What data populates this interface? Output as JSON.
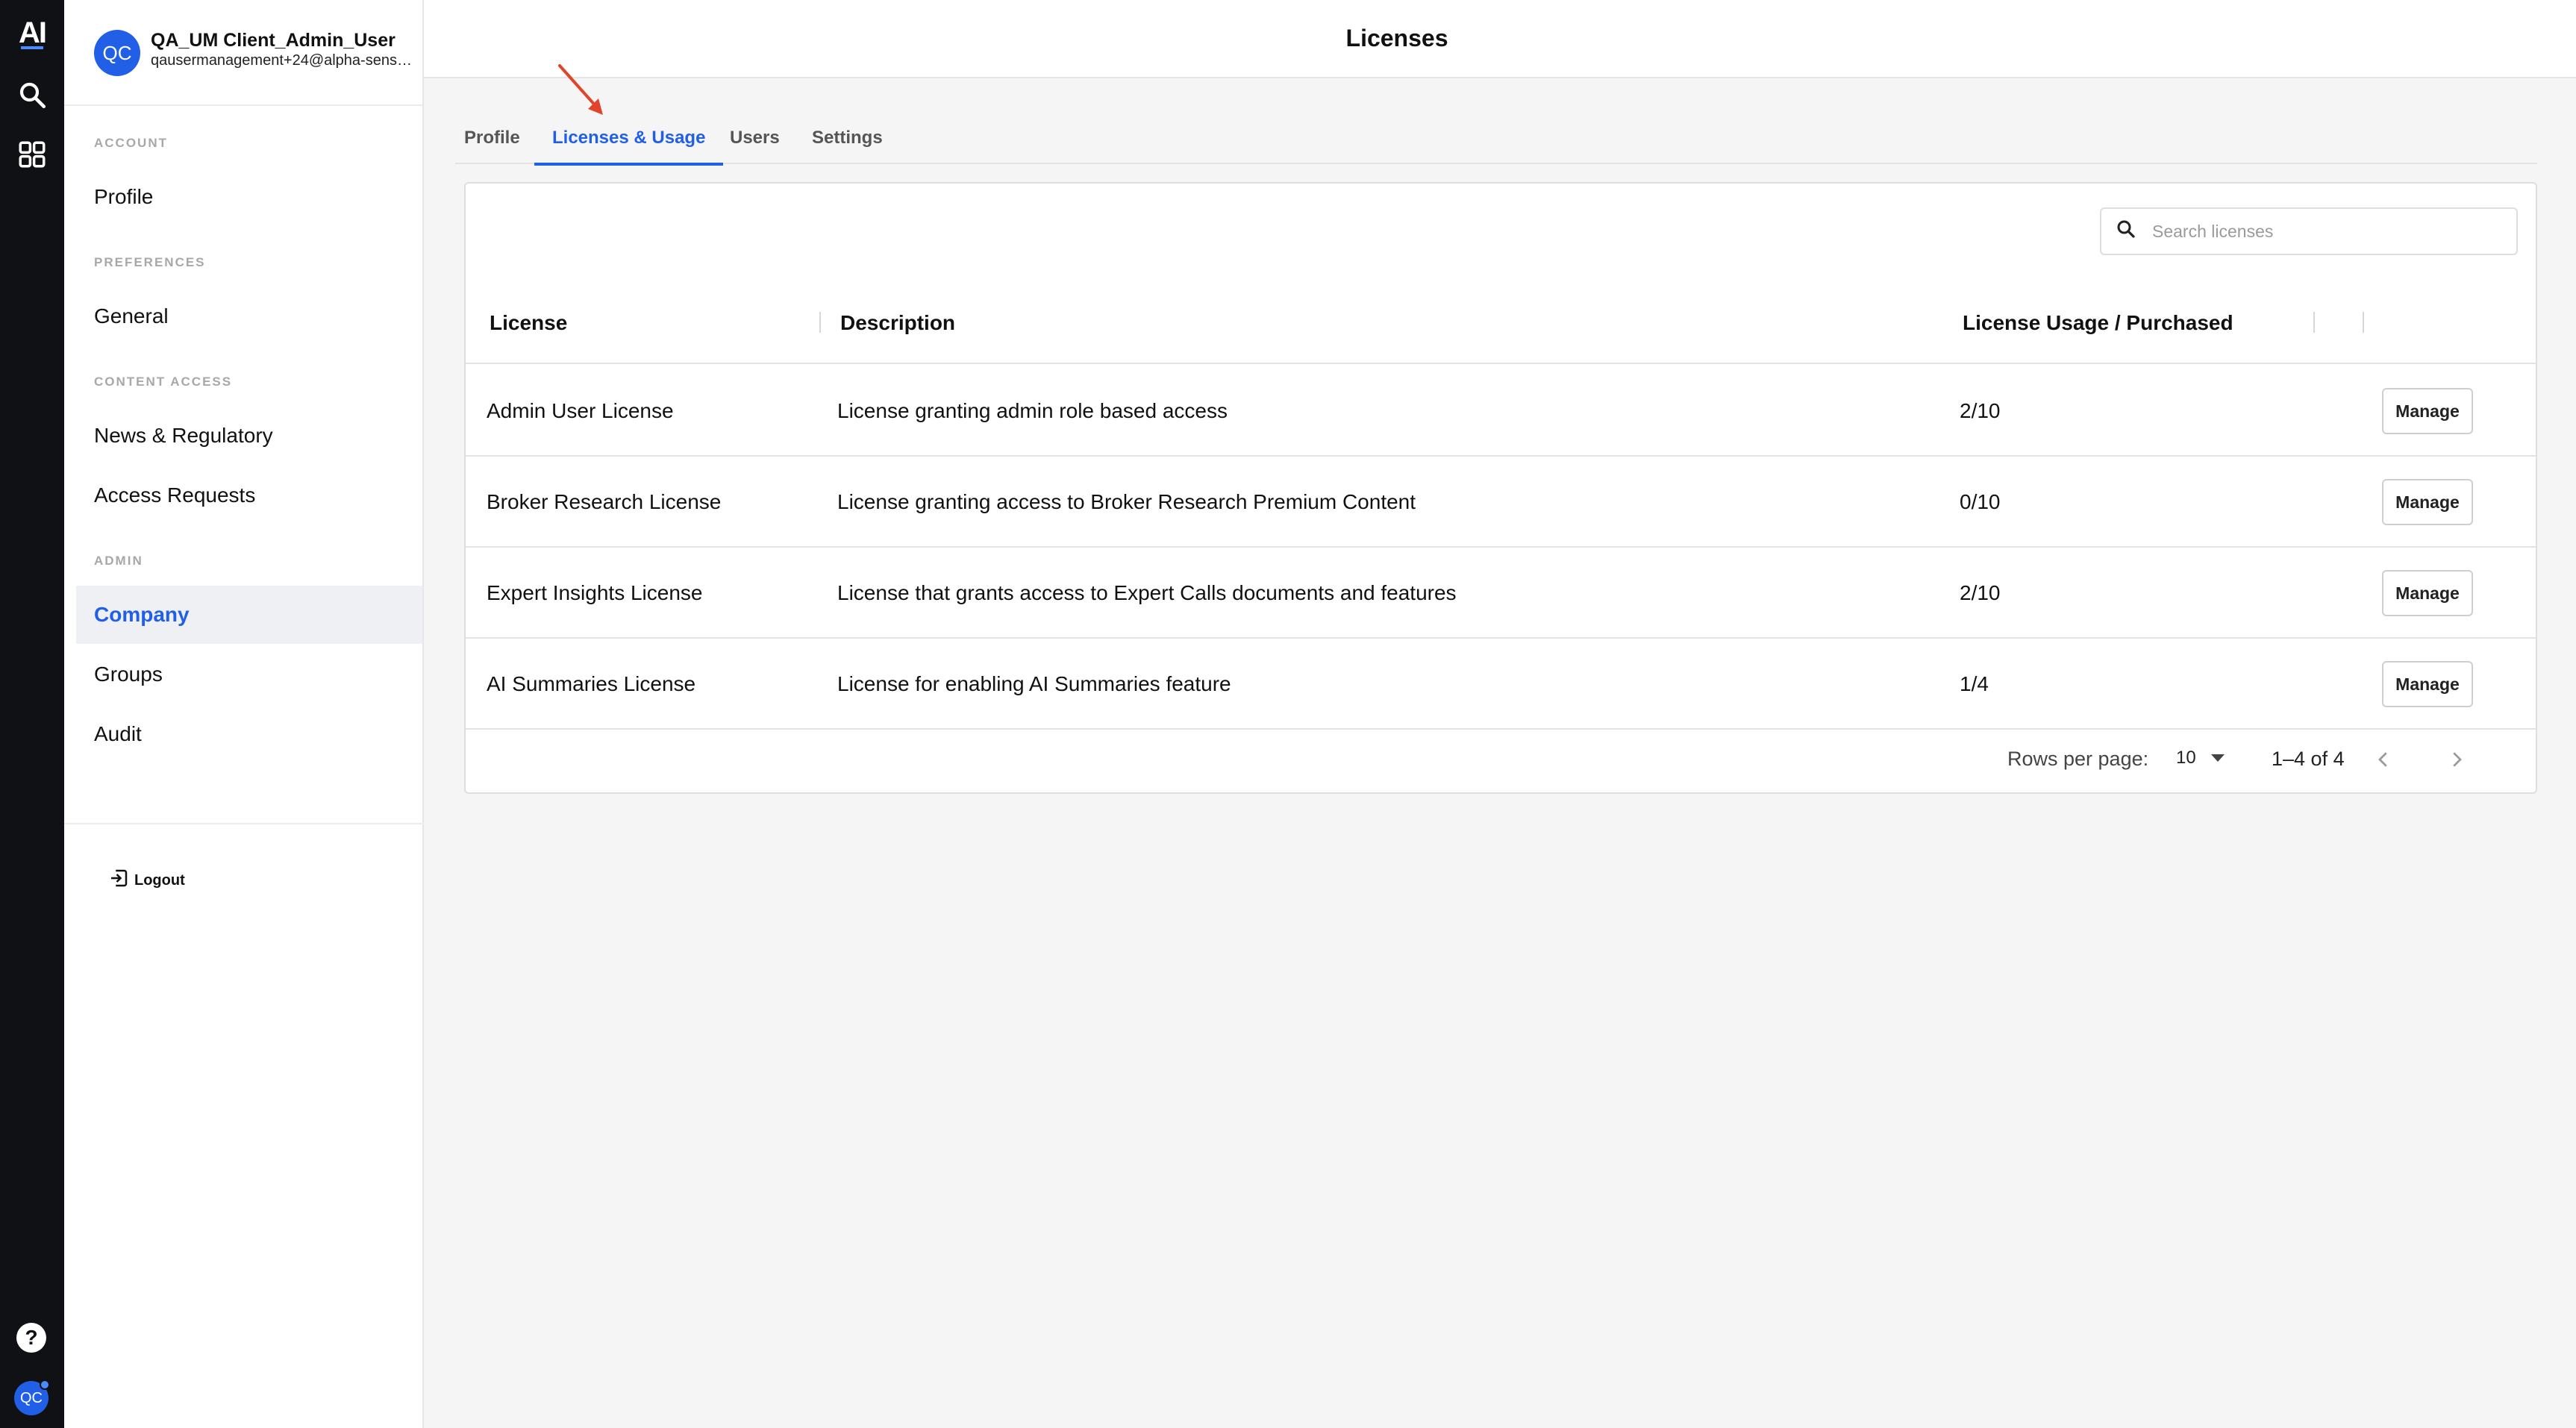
{
  "rail": {
    "logo": "AI",
    "help": "?",
    "avatar": "QC"
  },
  "user": {
    "initials": "QC",
    "name": "QA_UM Client_Admin_User",
    "email": "qausermanagement+24@alpha-sense.com"
  },
  "sidebar": {
    "sections": {
      "account": "ACCOUNT",
      "preferences": "PREFERENCES",
      "content_access": "CONTENT ACCESS",
      "admin": "ADMIN"
    },
    "items": {
      "profile": "Profile",
      "general": "General",
      "news": "News & Regulatory",
      "access_requests": "Access Requests",
      "company": "Company",
      "groups": "Groups",
      "audit": "Audit"
    },
    "logout": "Logout"
  },
  "header": {
    "title": "Licenses"
  },
  "tabs": [
    {
      "label": "Profile"
    },
    {
      "label": "Licenses & Usage"
    },
    {
      "label": "Users"
    },
    {
      "label": "Settings"
    }
  ],
  "search": {
    "placeholder": "Search licenses"
  },
  "table": {
    "columns": [
      "License",
      "Description",
      "License Usage / Purchased"
    ],
    "rows": [
      {
        "license": "Admin User License",
        "description": "License granting admin role based access",
        "usage": "2/10",
        "action": "Manage"
      },
      {
        "license": "Broker Research License",
        "description": "License granting access to Broker Research Premium Content",
        "usage": "0/10",
        "action": "Manage"
      },
      {
        "license": "Expert Insights License",
        "description": "License that grants access to Expert Calls documents and features",
        "usage": "2/10",
        "action": "Manage"
      },
      {
        "license": "AI Summaries License",
        "description": "License for enabling AI Summaries feature",
        "usage": "1/4",
        "action": "Manage"
      }
    ]
  },
  "pagination": {
    "rows_per_page_label": "Rows per page:",
    "rows_per_page": "10",
    "range": "1–4 of 4"
  },
  "colors": {
    "accent": "#2160e6",
    "rail": "#101114",
    "annotation_arrow": "#e0452b"
  }
}
